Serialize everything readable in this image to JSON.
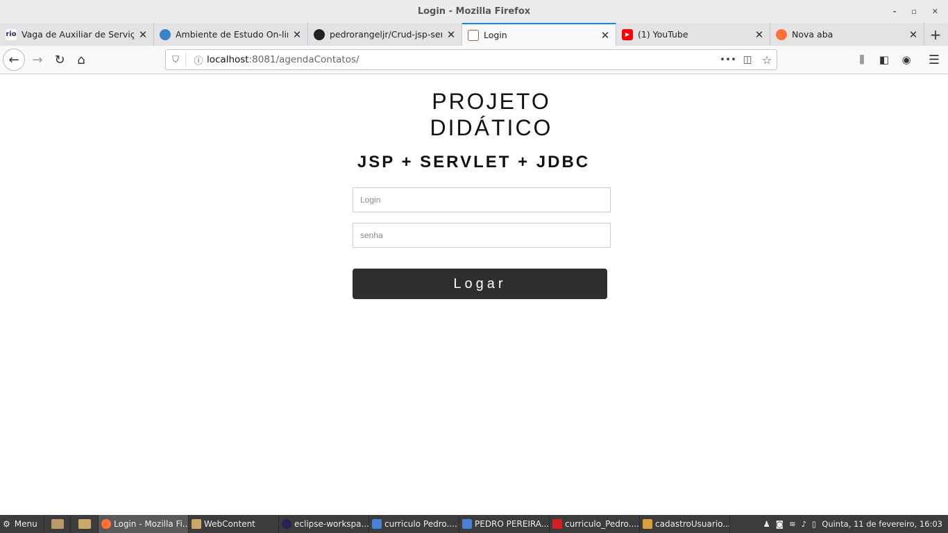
{
  "window": {
    "title": "Login - Mozilla Firefox",
    "controls": [
      "-",
      "▫",
      "✕"
    ]
  },
  "tabs": [
    {
      "label": "Vaga de Auxiliar de Serviço",
      "icon": "rio-icon",
      "color": "#1a2b6b",
      "active": false
    },
    {
      "label": "Ambiente de Estudo On-line",
      "icon": "globe-icon",
      "color": "#3b82c4",
      "active": false
    },
    {
      "label": "pedrorangeljr/Crud-jsp-serv",
      "icon": "github-icon",
      "color": "#222222",
      "active": false
    },
    {
      "label": "Login",
      "icon": "page-icon",
      "color": "#8a6a3a",
      "active": true
    },
    {
      "label": "(1) YouTube",
      "icon": "youtube-icon",
      "color": "#ff0000",
      "active": false
    },
    {
      "label": "Nova aba",
      "icon": "firefox-icon",
      "color": "#ff7139",
      "active": false
    }
  ],
  "nav": {
    "url_host": "localhost",
    "url_path": ":8081/agendaContatos/"
  },
  "page": {
    "title_line1": "PROJETO",
    "title_line2": "DIDÁTICO",
    "subtitle": "JSP + SERVLET + JDBC",
    "login_placeholder": "Login",
    "password_placeholder": "senha",
    "login_button": "Logar"
  },
  "taskbar": {
    "menu_label": "Menu",
    "items": [
      {
        "label": "Login - Mozilla Fi...",
        "active": true,
        "color": "#ff7139"
      },
      {
        "label": "WebContent",
        "active": false,
        "color": "#c9a86a"
      },
      {
        "label": "eclipse-workspa...",
        "active": false,
        "color": "#2c2255"
      },
      {
        "label": "curriculo Pedro....",
        "active": false,
        "color": "#4a7fd4"
      },
      {
        "label": "PEDRO PEREIRA...",
        "active": false,
        "color": "#4a7fd4"
      },
      {
        "label": "curriculo_Pedro....",
        "active": false,
        "color": "#d42020"
      },
      {
        "label": "cadastroUsuario...",
        "active": false,
        "color": "#d8a040"
      }
    ],
    "clock": "Quinta, 11 de fevereiro, 16:03"
  }
}
